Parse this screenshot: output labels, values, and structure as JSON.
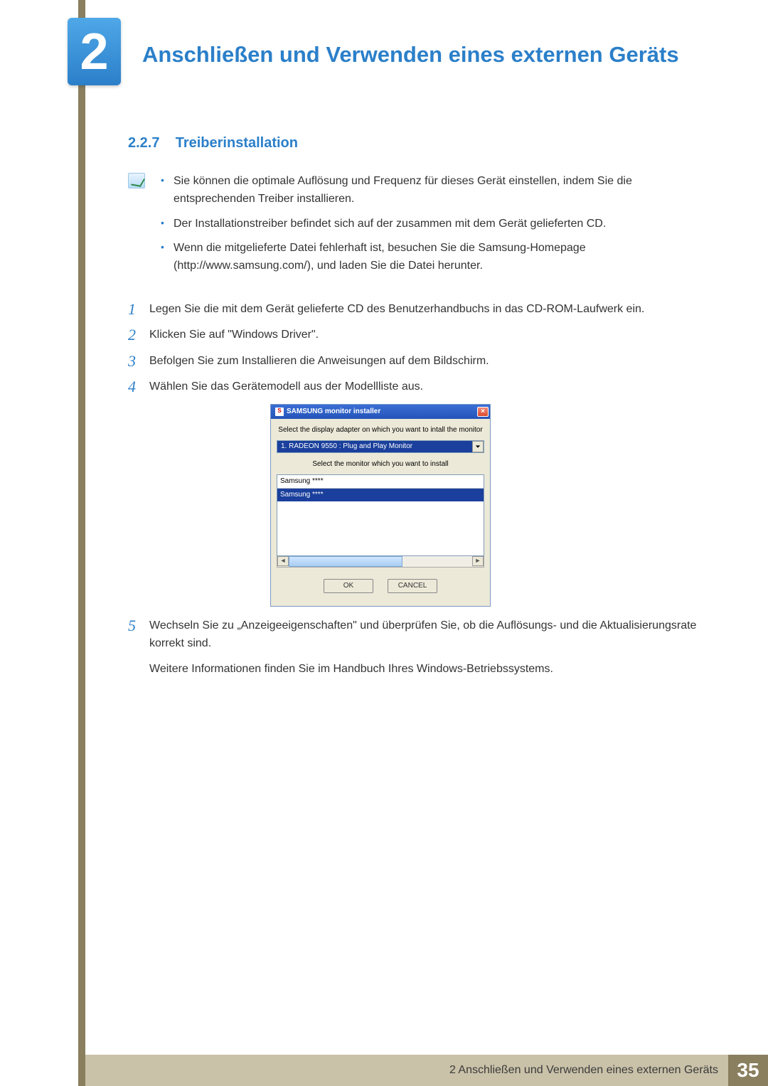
{
  "chapter": {
    "number": "2",
    "title": "Anschließen und Verwenden eines externen Geräts"
  },
  "section": {
    "number": "2.2.7",
    "title": "Treiberinstallation"
  },
  "notes": [
    "Sie können die optimale Auflösung und Frequenz für dieses Gerät einstellen, indem Sie die entsprechenden Treiber installieren.",
    "Der Installationstreiber befindet sich auf der zusammen mit dem Gerät gelieferten CD.",
    "Wenn die mitgelieferte Datei fehlerhaft ist, besuchen Sie die Samsung-Homepage (http://www.samsung.com/), und laden Sie die Datei herunter."
  ],
  "steps": {
    "s1": {
      "n": "1",
      "t": "Legen Sie die mit dem Gerät gelieferte CD des Benutzerhandbuchs in das CD-ROM-Laufwerk ein."
    },
    "s2": {
      "n": "2",
      "t": "Klicken Sie auf \"Windows Driver\"."
    },
    "s3": {
      "n": "3",
      "t": "Befolgen Sie zum Installieren die Anweisungen auf dem Bildschirm."
    },
    "s4": {
      "n": "4",
      "t": "Wählen Sie das Gerätemodell aus der Modellliste aus."
    },
    "s5": {
      "n": "5",
      "t": "Wechseln Sie zu „Anzeigeeigenschaften\" und überprüfen Sie, ob die Auflösungs- und die Aktualisierungsrate korrekt sind."
    },
    "s5b": "Weitere Informationen finden Sie im Handbuch Ihres Windows-Betriebssystems."
  },
  "dialog": {
    "title": "SAMSUNG monitor installer",
    "label1": "Select the display adapter on which you want to intall the monitor",
    "dropdown_value": "1. RADEON 9550 : Plug and Play Monitor",
    "label2": "Select the monitor which you want to install",
    "list_header": "Samsung ****",
    "list_selected": "Samsung ****",
    "ok": "OK",
    "cancel": "CANCEL"
  },
  "footer": {
    "text": "2 Anschließen und Verwenden eines externen Geräts",
    "page": "35"
  }
}
